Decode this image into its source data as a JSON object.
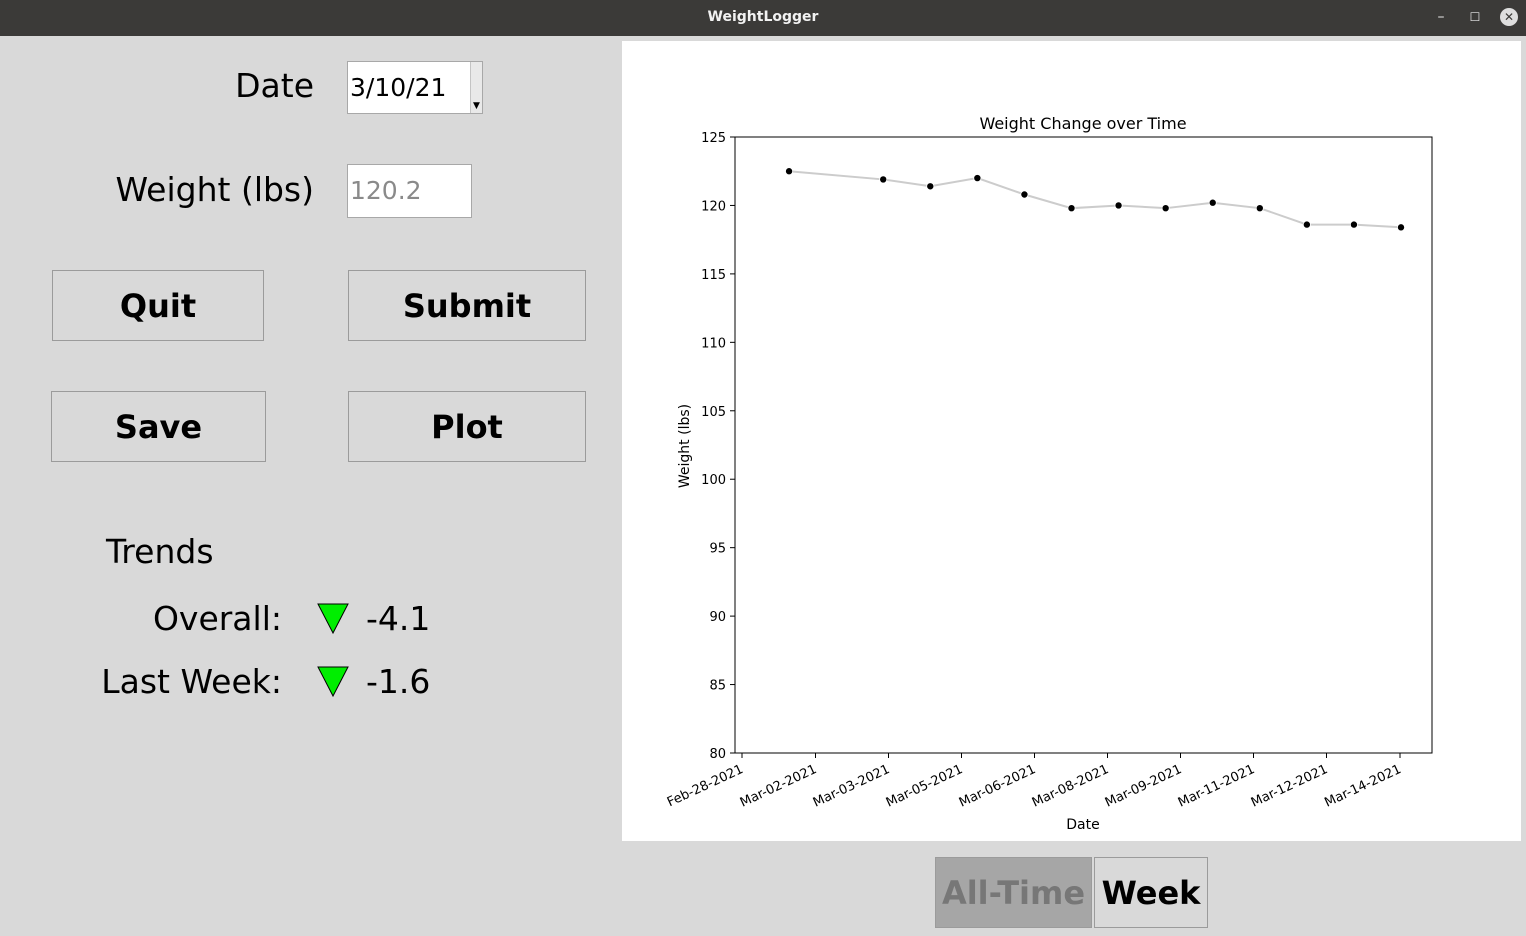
{
  "window": {
    "title": "WeightLogger"
  },
  "form": {
    "date_label": "Date",
    "date_value": "3/10/21",
    "weight_label": "Weight (lbs)",
    "weight_placeholder": "120.2"
  },
  "buttons": {
    "quit": "Quit",
    "submit": "Submit",
    "save": "Save",
    "plot": "Plot"
  },
  "trends": {
    "heading": "Trends",
    "overall_label": "Overall:",
    "overall_value": "-4.1",
    "last_week_label": "Last Week:",
    "last_week_value": "-1.6",
    "down_color": "#00ee00"
  },
  "view_tabs": {
    "all_time": "All-Time",
    "week": "Week",
    "active": "all_time"
  },
  "chart_data": {
    "type": "line",
    "title": "Weight Change over Time",
    "xlabel": "Date",
    "ylabel": "Weight (lbs)",
    "ylim": [
      80,
      125
    ],
    "yticks": [
      80,
      85,
      90,
      95,
      100,
      105,
      110,
      115,
      120,
      125
    ],
    "xticks": [
      "Feb-28-2021",
      "Mar-02-2021",
      "Mar-03-2021",
      "Mar-05-2021",
      "Mar-06-2021",
      "Mar-08-2021",
      "Mar-09-2021",
      "Mar-11-2021",
      "Mar-12-2021",
      "Mar-14-2021"
    ],
    "x": [
      "2021-03-01",
      "2021-03-03",
      "2021-03-04",
      "2021-03-05",
      "2021-03-06",
      "2021-03-07",
      "2021-03-08",
      "2021-03-09",
      "2021-03-10",
      "2021-03-11",
      "2021-03-12",
      "2021-03-13",
      "2021-03-14"
    ],
    "values": [
      122.5,
      121.9,
      121.4,
      122.0,
      120.8,
      119.8,
      120.0,
      119.8,
      120.2,
      119.8,
      118.6,
      118.6,
      118.4
    ],
    "line_color": "#cccccc",
    "marker_color": "#000000",
    "grid": false
  }
}
